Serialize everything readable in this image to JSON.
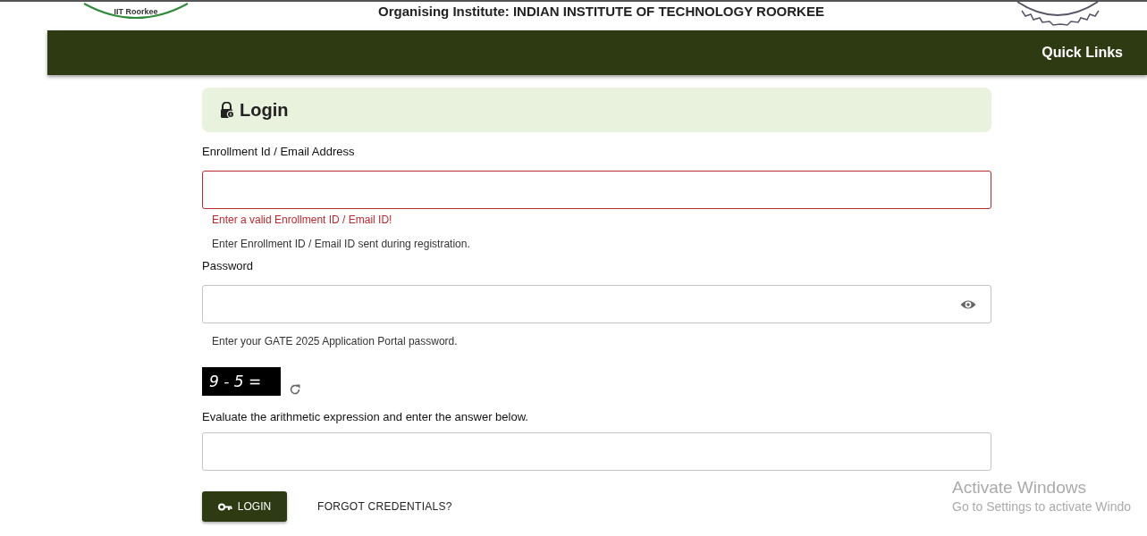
{
  "header": {
    "logo_text": "IIT Roorkee",
    "organiser": "Organising Institute: INDIAN INSTITUTE OF TECHNOLOGY ROORKEE"
  },
  "navbar": {
    "links": [
      "Quick Links"
    ]
  },
  "login": {
    "title": "Login",
    "fields": [
      {
        "kind": "text",
        "label": "Enrollment Id / Email Address",
        "invalid": true,
        "error": "Enter a valid Enrollment ID / Email ID!",
        "help": "Enter Enrollment ID / Email ID sent during registration."
      },
      {
        "kind": "password",
        "label": "Password",
        "invalid": false,
        "help": "Enter your GATE 2025 Application Portal password."
      }
    ],
    "captcha": {
      "expression": "9 - 5 =",
      "instruction": "Evaluate the arithmetic expression and enter the answer below."
    },
    "buttons": [
      {
        "kind": "primary",
        "label": "LOGIN"
      },
      {
        "kind": "link",
        "label": "FORGOT CREDENTIALS?"
      }
    ]
  },
  "windows_notice": {
    "title": "Activate Windows",
    "text": "Go to Settings to activate Windo"
  }
}
